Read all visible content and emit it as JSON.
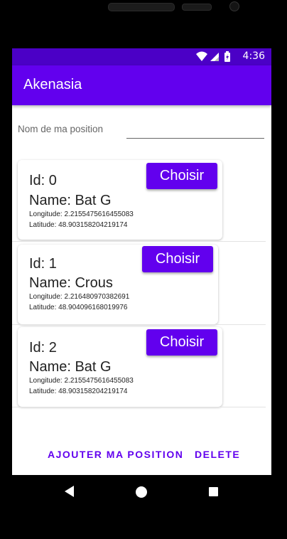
{
  "status_bar": {
    "time": "4:36"
  },
  "app_bar": {
    "title": "Akenasia"
  },
  "position_form": {
    "label": "Nom de ma position",
    "value": "",
    "placeholder": ""
  },
  "cards": [
    {
      "id_text": "Id: 0",
      "name_text": "Name: Bat G",
      "longitude_text": "Longitude: 2.2155475616455083",
      "latitude_text": "Latitude: 48.903158204219174",
      "button_label": "Choisir"
    },
    {
      "id_text": "Id: 1",
      "name_text": "Name: Crous",
      "longitude_text": "Longitude: 2.216480970382691",
      "latitude_text": "Latitude: 48.904096168019976",
      "button_label": "Choisir"
    },
    {
      "id_text": "Id: 2",
      "name_text": "Name: Bat G",
      "longitude_text": "Longitude: 2.2155475616455083",
      "latitude_text": "Latitude: 48.903158204219174",
      "button_label": "Choisir"
    }
  ],
  "footer": {
    "add_label": "AJOUTER MA POSITION",
    "delete_label": "DELETE"
  },
  "colors": {
    "primary": "#6200ee",
    "status_bar": "#4b00c6",
    "text": "#222222"
  },
  "icons": {
    "wifi": "wifi-icon",
    "signal": "signal-icon",
    "battery": "battery-icon",
    "back": "back-icon",
    "home": "home-icon",
    "recents": "recents-icon"
  }
}
